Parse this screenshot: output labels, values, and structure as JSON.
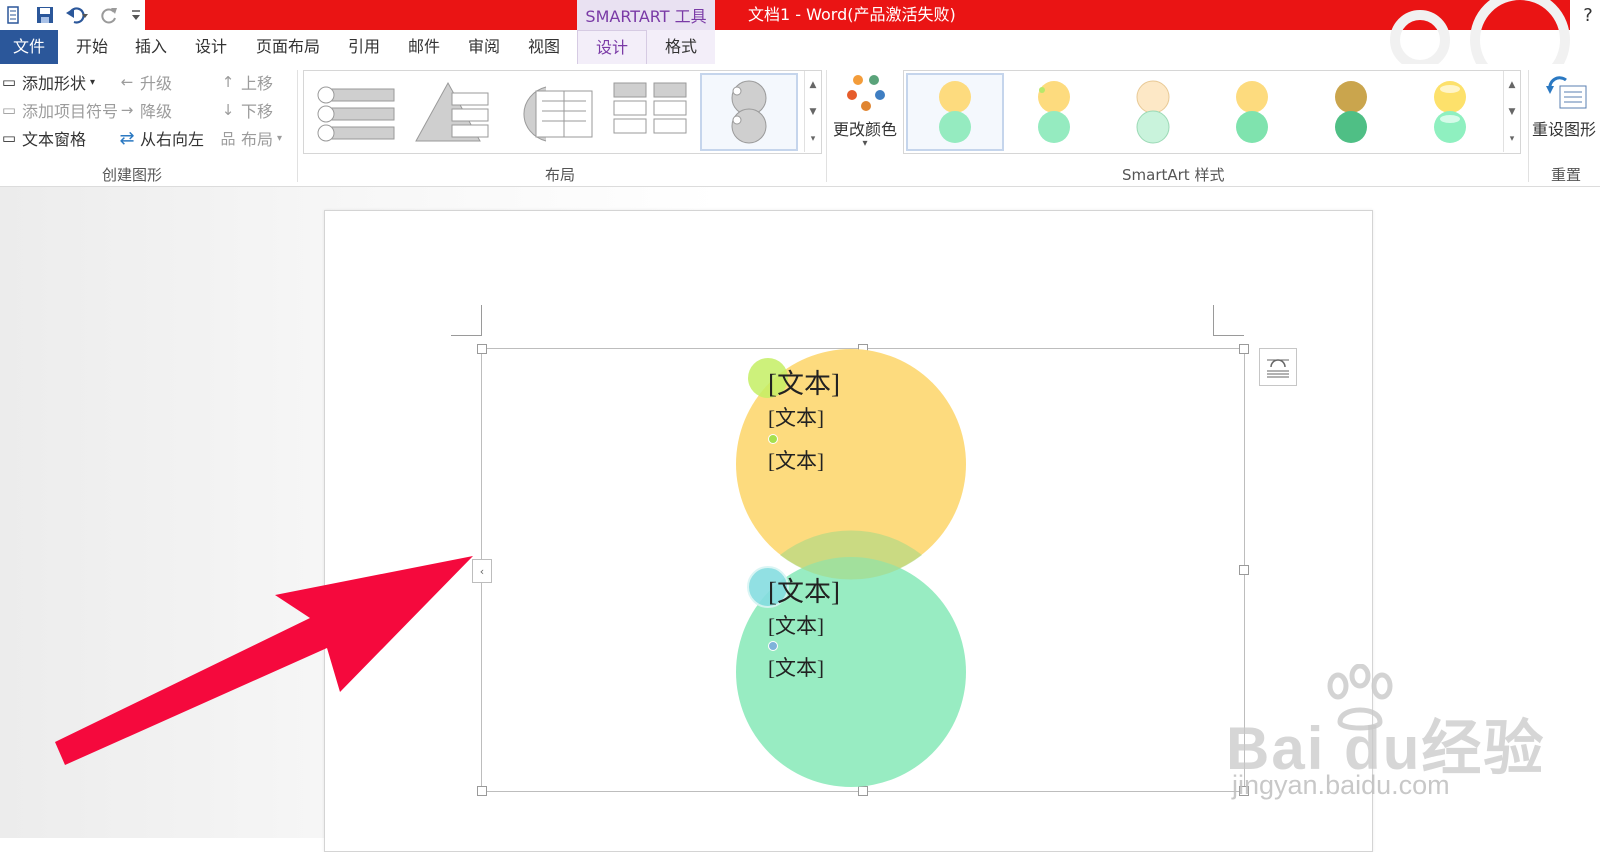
{
  "colors": {
    "titlebar_red": "#ea1414",
    "file_tab": "#2b579a",
    "context_tab_text": "#7a3aa6",
    "circle_yellow": "#fddb7e",
    "circle_green": "#95ebc0",
    "arrow_red": "#f5093d"
  },
  "title_bar": {
    "context_label": "SMARTART 工具",
    "window_title": "文档1 - Word(产品激活失败)",
    "help": "?",
    "qat_icons": [
      "save-icon",
      "undo-icon",
      "redo-icon",
      "customize-qat-icon"
    ]
  },
  "tabs": [
    {
      "label": "文件"
    },
    {
      "label": "开始"
    },
    {
      "label": "插入"
    },
    {
      "label": "设计"
    },
    {
      "label": "页面布局"
    },
    {
      "label": "引用"
    },
    {
      "label": "邮件"
    },
    {
      "label": "审阅"
    },
    {
      "label": "视图"
    },
    {
      "label": "设计"
    },
    {
      "label": "格式"
    }
  ],
  "ribbon": {
    "create_graphic": {
      "label": "创建图形",
      "add_shape": "添加形状",
      "add_bullet": "添加项目符号",
      "text_pane": "文本窗格",
      "promote": "升级",
      "demote": "降级",
      "right_to_left": "从右向左",
      "move_up": "上移",
      "move_down": "下移",
      "layout": "布局"
    },
    "layouts": {
      "label": "布局"
    },
    "smartart_styles": {
      "label": "SmartArt 样式",
      "change_colors": "更改颜色"
    },
    "reset": {
      "label": "重置",
      "reset_graphic": "重设图形"
    }
  },
  "smartart": {
    "groups": [
      {
        "title": "[文本]",
        "bullets": [
          "[文本]",
          "[文本]"
        ]
      },
      {
        "title": "[文本]",
        "bullets": [
          "[文本]",
          "[文本]"
        ]
      }
    ]
  },
  "watermark": {
    "brand": "Bai du经验",
    "url": "jingyan.baidu.com"
  }
}
